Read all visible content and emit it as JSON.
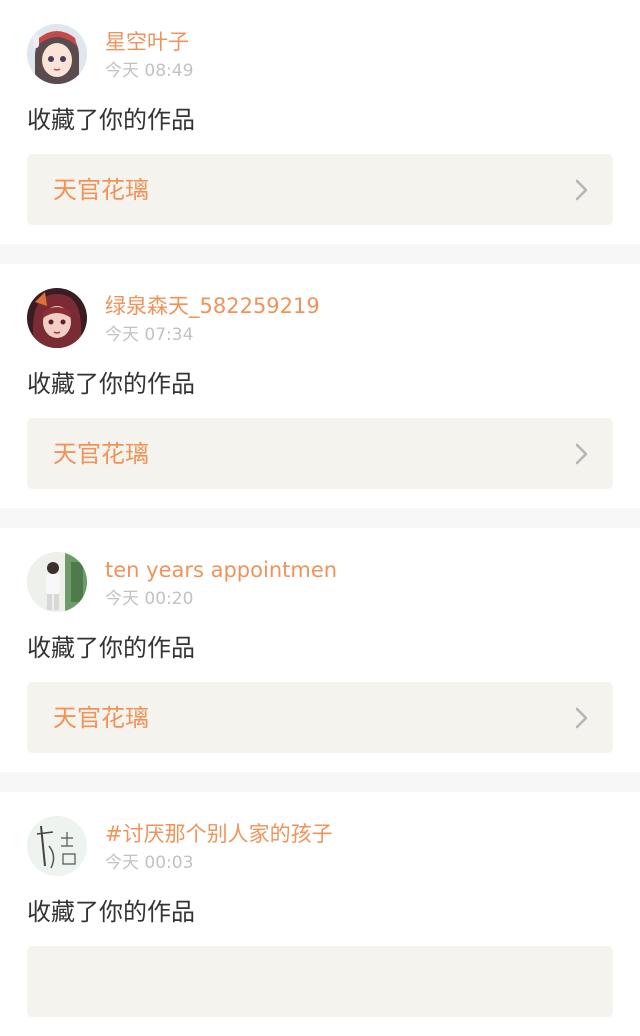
{
  "notifications": [
    {
      "username": "星空叶子",
      "timestamp": "今天 08:49",
      "action": "收藏了你的作品",
      "work_title": "天官花璃",
      "avatar_icon": "anime-girl-cap-avatar"
    },
    {
      "username": "绿泉森天_582259219",
      "timestamp": "今天 07:34",
      "action": "收藏了你的作品",
      "work_title": "天官花璃",
      "avatar_icon": "anime-girl-red-avatar"
    },
    {
      "username": "ten years appointmen",
      "timestamp": "今天 00:20",
      "action": "收藏了你的作品",
      "work_title": "天官花璃",
      "avatar_icon": "person-photo-avatar"
    },
    {
      "username": "#讨厌那个别人家的孩子",
      "timestamp": "今天 00:03",
      "action": "收藏了你的作品",
      "work_title": "",
      "avatar_icon": "calligraphy-avatar"
    }
  ],
  "colors": {
    "accent": "#f0935a",
    "timestamp": "#c2c2c2",
    "text": "#333333",
    "link_bg": "#f4f3ee",
    "separator": "#f7f7f7"
  }
}
